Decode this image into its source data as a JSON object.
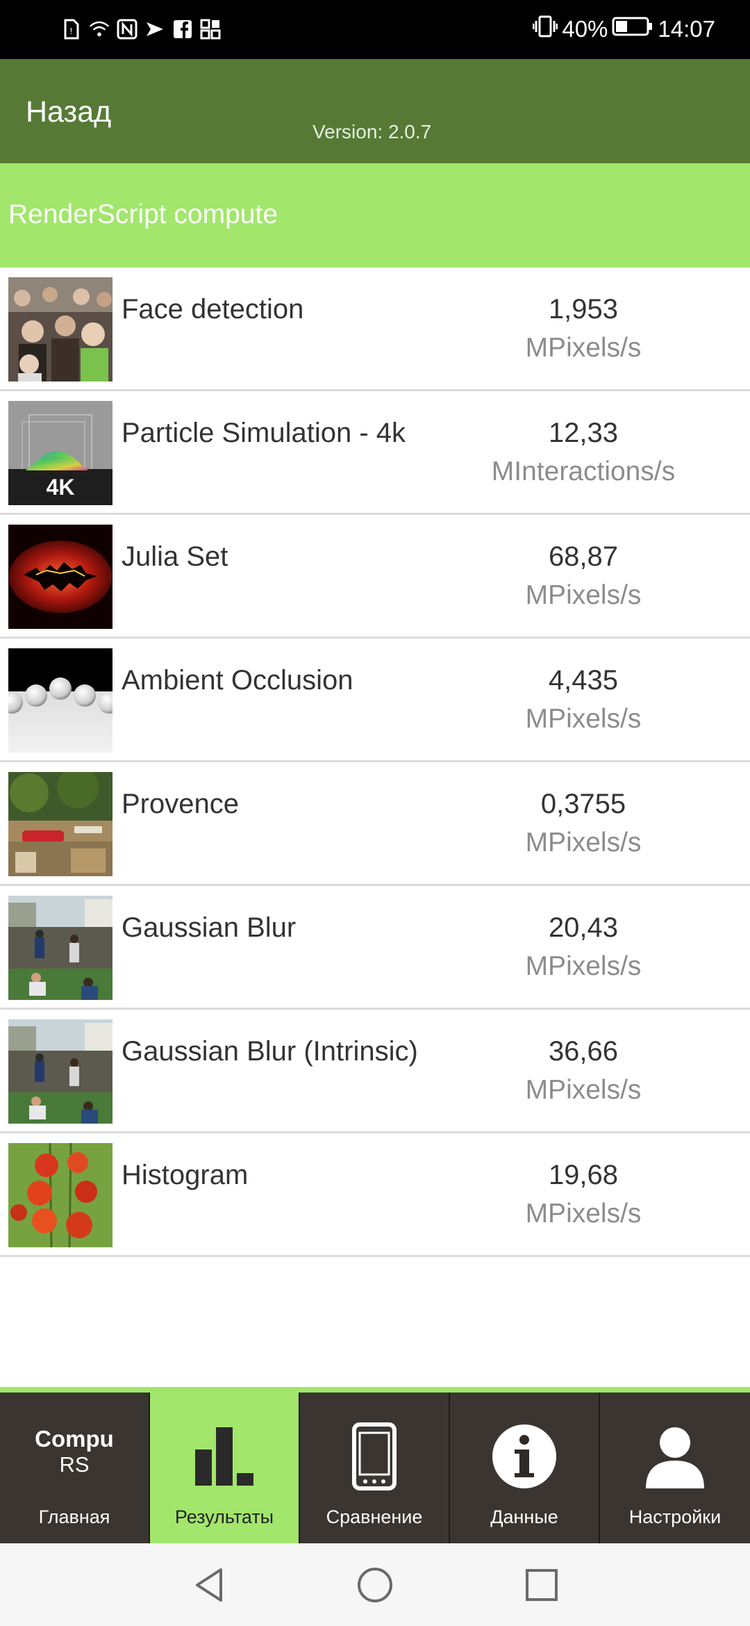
{
  "status_bar": {
    "battery": "40%",
    "time": "14:07",
    "icons": [
      "sim-icon",
      "wifi-icon",
      "nfc-icon",
      "email-icon",
      "facebook-icon",
      "apps-icon",
      "vibrate-icon",
      "battery-icon"
    ]
  },
  "header": {
    "back_label": "Назад",
    "version": "Version: 2.0.7"
  },
  "section": {
    "title": "RenderScript compute"
  },
  "results": [
    {
      "name": "Face detection",
      "value": "1,953",
      "unit": "MPixels/s",
      "thumb": "crowd-image"
    },
    {
      "name": "Particle Simulation - 4k",
      "value": "12,33",
      "unit": "MInteractions/s",
      "thumb": "particle-image",
      "thumb_label": "4K"
    },
    {
      "name": "Julia Set",
      "value": "68,87",
      "unit": "MPixels/s",
      "thumb": "fractal-image"
    },
    {
      "name": "Ambient Occlusion",
      "value": "4,435",
      "unit": "MPixels/s",
      "thumb": "spheres-image"
    },
    {
      "name": "Provence",
      "value": "0,3755",
      "unit": "MPixels/s",
      "thumb": "street-image"
    },
    {
      "name": "Gaussian Blur",
      "value": "20,43",
      "unit": "MPixels/s",
      "thumb": "market-image"
    },
    {
      "name": "Gaussian Blur (Intrinsic)",
      "value": "36,66",
      "unit": "MPixels/s",
      "thumb": "market-image"
    },
    {
      "name": "Histogram",
      "value": "19,68",
      "unit": "MPixels/s",
      "thumb": "tomatoes-image"
    }
  ],
  "nav": {
    "logo_top": "Compu",
    "logo_bottom": "RS",
    "tabs": [
      {
        "label": "Главная",
        "icon": "logo-icon"
      },
      {
        "label": "Результаты",
        "icon": "bar-chart-icon",
        "active": true
      },
      {
        "label": "Сравнение",
        "icon": "phone-icon"
      },
      {
        "label": "Данные",
        "icon": "info-icon"
      },
      {
        "label": "Настройки",
        "icon": "user-icon"
      }
    ]
  },
  "colors": {
    "header": "#567a36",
    "accent": "#a2e66b",
    "nav_bg": "#3a3530"
  }
}
